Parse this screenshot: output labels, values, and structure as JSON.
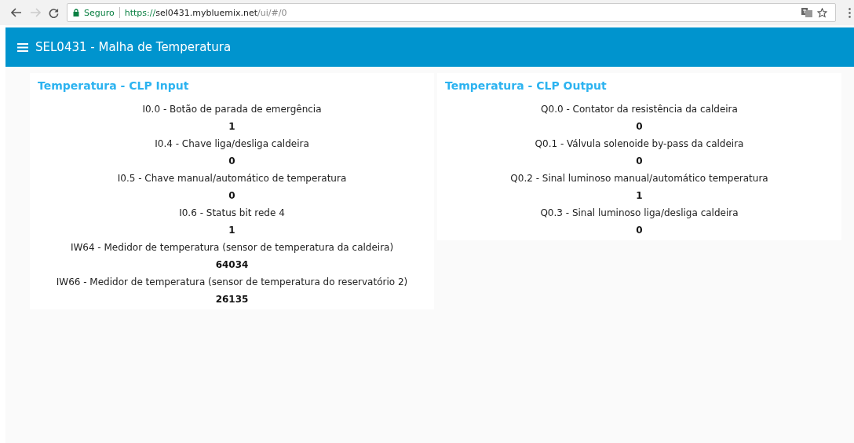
{
  "browser": {
    "security_label": "Seguro",
    "url": {
      "scheme": "https://",
      "host": "sel0431.mybluemix.net",
      "path": "/ui/#/0"
    }
  },
  "app_bar": {
    "title": "SEL0431 - Malha de Temperatura"
  },
  "cards": [
    {
      "title": "Temperatura - CLP Input",
      "items": [
        {
          "label": "I0.0 - Botão de parada de emergência",
          "value": "1"
        },
        {
          "label": "I0.4 - Chave liga/desliga caldeira",
          "value": "0"
        },
        {
          "label": "I0.5 - Chave manual/automático de temperatura",
          "value": "0"
        },
        {
          "label": "I0.6 - Status bit rede 4",
          "value": "1"
        },
        {
          "label": "IW64 - Medidor de temperatura (sensor de temperatura da caldeira)",
          "value": "64034"
        },
        {
          "label": "IW66 - Medidor de temperatura (sensor de temperatura do reservatório 2)",
          "value": "26135"
        }
      ]
    },
    {
      "title": "Temperatura - CLP Output",
      "items": [
        {
          "label": "Q0.0 - Contator da resistência da caldeira",
          "value": "0"
        },
        {
          "label": "Q0.1 - Válvula solenoide by-pass da caldeira",
          "value": "0"
        },
        {
          "label": "Q0.2 - Sinal luminoso manual/automático temperatura",
          "value": "1"
        },
        {
          "label": "Q0.3 - Sinal luminoso liga/desliga caldeira",
          "value": "0"
        }
      ]
    }
  ]
}
